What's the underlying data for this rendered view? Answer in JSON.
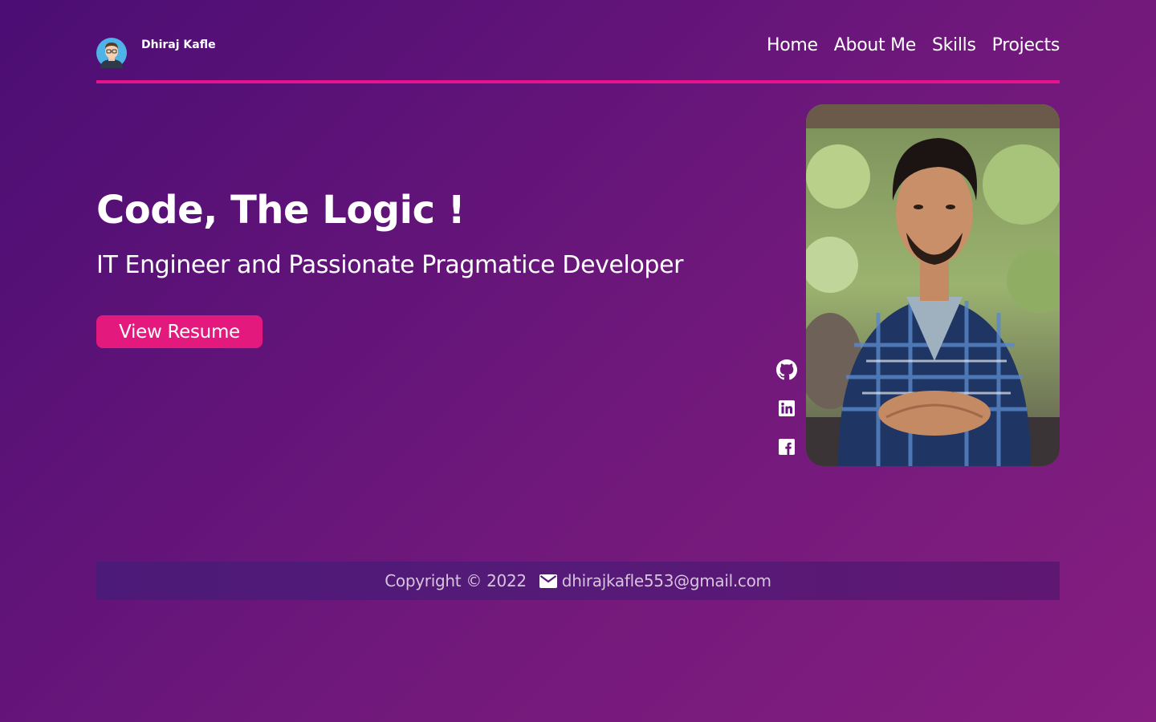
{
  "header": {
    "brand_name": "Dhiraj Kafle",
    "avatar_icon": "developer-avatar-icon",
    "nav": [
      {
        "label": "Home"
      },
      {
        "label": "About Me"
      },
      {
        "label": "Skills"
      },
      {
        "label": "Projects"
      }
    ]
  },
  "hero": {
    "title": "Code, The Logic !",
    "subtitle": "IT Engineer and Passionate Pragmatice Developer",
    "resume_button": "View Resume"
  },
  "social_icons": [
    "github-icon",
    "linkedin-icon",
    "facebook-icon"
  ],
  "footer": {
    "copyright": "Copyright © 2022",
    "email_icon": "mail-icon",
    "email": "dhirajkafle553@gmail.com"
  },
  "colors": {
    "accent": "#e8138c",
    "button": "#e3197d",
    "background_start": "#4b0e74",
    "background_end": "#851e80"
  }
}
